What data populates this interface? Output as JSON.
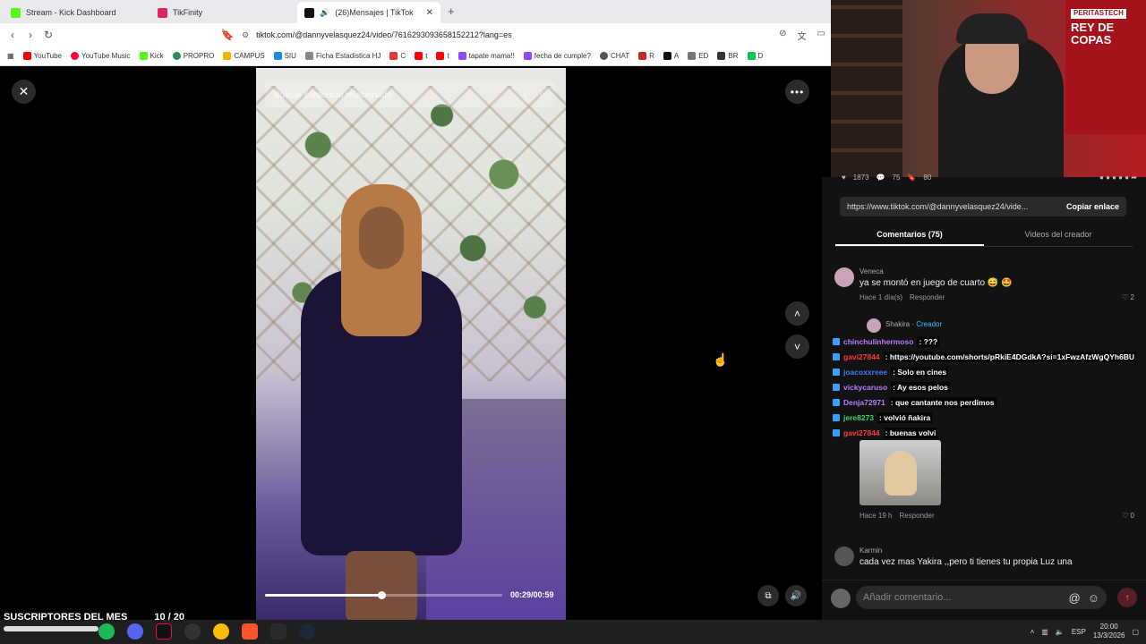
{
  "browser": {
    "tabs": [
      {
        "title": "Stream - Kick Dashboard",
        "color": "#53fc18"
      },
      {
        "title": "TikFinity",
        "color": "#e0245e"
      },
      {
        "title": "(26)Mensajes | TikTok",
        "color": "#111111"
      }
    ],
    "url": "tiktok.com/@dannyvelasquez24/video/7616293093658152212?lang=es",
    "bookmarks": [
      {
        "label": "YouTube",
        "color": "#ff0000"
      },
      {
        "label": "YouTube Music",
        "color": "#ff0033"
      },
      {
        "label": "Kick",
        "color": "#53fc18"
      },
      {
        "label": "PROPRO",
        "color": "#2e8b57"
      },
      {
        "label": "CAMPUS",
        "color": "#f4b400"
      },
      {
        "label": "SIU",
        "color": "#1e88e5"
      },
      {
        "label": "Ficha Estadistica HJ",
        "color": "#888888"
      },
      {
        "label": "C",
        "color": "#e53935"
      },
      {
        "label": "t",
        "color": "#ff0000"
      },
      {
        "label": "t",
        "color": "#ff0000"
      },
      {
        "label": "tapate mama!!",
        "color": "#9146ff"
      },
      {
        "label": "fecha de cumple?",
        "color": "#9146ff"
      },
      {
        "label": "CHAT",
        "color": "#555555"
      },
      {
        "label": "R",
        "color": "#c62828"
      },
      {
        "label": "A",
        "color": "#111111"
      },
      {
        "label": "ED",
        "color": "#777777"
      },
      {
        "label": "BR",
        "color": "#333333"
      },
      {
        "label": "D",
        "color": "#00c853"
      }
    ]
  },
  "video": {
    "search_placeholder": "Buscar contenido relacionado",
    "time": "00:29/00:59",
    "progress_fraction": 0.49
  },
  "actions": {
    "likes": "1873",
    "comments": "75",
    "saves": "80"
  },
  "share": {
    "link": "https://www.tiktok.com/@dannyvelasquez24/vide...",
    "copy_label": "Copiar enlace"
  },
  "comment_tabs": [
    "Comentarios (75)",
    "Videos del creador"
  ],
  "comments": [
    {
      "user": "Veneca",
      "text": "ya se montó en juego de cuarto 😅 🤩",
      "time": "Hace 1 día(s)",
      "reply": "Responder",
      "likes": "2"
    },
    {
      "user": "Shakira",
      "tag": "Creador"
    },
    {
      "time": "Hace 19 h",
      "reply": "Responder",
      "likes": "0"
    },
    {
      "user": "Karmin",
      "text": "cada vez mas Yakira ,,pero ti tienes tu propia Luz una"
    }
  ],
  "chat": [
    {
      "user": "chinchulinhermoso",
      "msg": ": ???",
      "color": "#b57cff"
    },
    {
      "user": "gavi27844",
      "msg": ": https://youtube.com/shorts/pRkiE4DGdkA?si=1xFwzAfzWgQYh6BU",
      "color": "#ff3b3b"
    },
    {
      "user": "joacoxxreee",
      "msg": ": Solo en cines",
      "color": "#3f7bff"
    },
    {
      "user": "vickycaruso",
      "msg": ": Ay esos pelos",
      "color": "#b57cff"
    },
    {
      "user": "Denja72971",
      "msg": ": que cantante nos perdimos",
      "color": "#b57cff"
    },
    {
      "user": "jere8273",
      "msg": ": volvió ñakira",
      "color": "#3ad36a"
    },
    {
      "user": "gavi27844",
      "msg": ": buenas volvi",
      "color": "#ff3b3b"
    }
  ],
  "comment_input": {
    "placeholder": "Añadir comentario..."
  },
  "webcam_banner": {
    "tag": "PERITASTECH",
    "text": "REY DE COPAS"
  },
  "overlay": {
    "label": "SUSCRIPTORES DEL MES",
    "count": "10",
    "goal": "/ 20"
  },
  "tray": {
    "lang": "ESP",
    "time": "20:00",
    "date": "13/3/2026"
  }
}
